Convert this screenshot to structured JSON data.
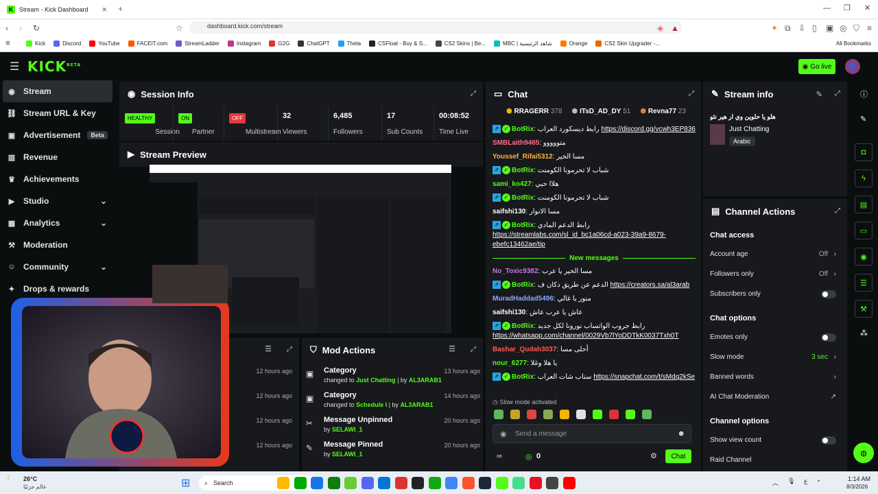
{
  "browser": {
    "tab_title": "Stream - Kick Dashboard",
    "url": "dashboard.kick.com/stream",
    "bookmarks": [
      {
        "label": "Kick",
        "color": "#53fc18"
      },
      {
        "label": "Discord",
        "color": "#5865f2"
      },
      {
        "label": "YouTube",
        "color": "#ff0000"
      },
      {
        "label": "FACEIT.com",
        "color": "#ff5500"
      },
      {
        "label": "StreamLadder",
        "color": "#6a5acd"
      },
      {
        "label": "Instagram",
        "color": "#c13584"
      },
      {
        "label": "G2G",
        "color": "#d33"
      },
      {
        "label": "ChatGPT",
        "color": "#333"
      },
      {
        "label": "Theta",
        "color": "#2a9df4"
      },
      {
        "label": "CSFloat - Buy & S...",
        "color": "#222"
      },
      {
        "label": "CS2 Skins | Be...",
        "color": "#444"
      },
      {
        "label": "MBC | شاهد الرئيسية",
        "color": "#1bb"
      },
      {
        "label": "Orange",
        "color": "#ff7900"
      },
      {
        "label": "CS2 Skin Upgrader -...",
        "color": "#e60"
      }
    ],
    "all_bookmarks": "All Bookmarks"
  },
  "topbar": {
    "logo": "KICK",
    "logo_beta": "BETA",
    "go_live": "Go live"
  },
  "sidebar": {
    "items": [
      {
        "label": "Stream",
        "icon": "broadcast-icon",
        "active": true
      },
      {
        "label": "Stream URL & Key",
        "icon": "link-icon"
      },
      {
        "label": "Advertisement",
        "icon": "ad-icon",
        "badge": "Beta"
      },
      {
        "label": "Revenue",
        "icon": "chart-icon"
      },
      {
        "label": "Achievements",
        "icon": "trophy-icon"
      },
      {
        "label": "Studio",
        "icon": "video-icon",
        "chevron": true
      },
      {
        "label": "Analytics",
        "icon": "analytics-icon",
        "chevron": true
      },
      {
        "label": "Moderation",
        "icon": "hammer-icon"
      },
      {
        "label": "Community",
        "icon": "users-icon",
        "chevron": true
      },
      {
        "label": "Drops & rewards",
        "icon": "gift-icon"
      }
    ]
  },
  "session": {
    "title": "Session Info",
    "stats": [
      {
        "badge": "HEALTHY",
        "badge_color": "#53fc18",
        "label": "Session"
      },
      {
        "badge": "ON",
        "badge_color": "#53fc18",
        "label": "Partner"
      },
      {
        "badge": "OFF",
        "badge_color": "#e53935",
        "label": "Multistream"
      },
      {
        "value": "32",
        "label": "Viewers"
      },
      {
        "value": "6,485",
        "label": "Followers"
      },
      {
        "value": "17",
        "label": "Sub Counts"
      },
      {
        "value": "00:08:52",
        "label": "Time Live"
      }
    ]
  },
  "preview": {
    "title": "Stream Preview"
  },
  "mod_actions": {
    "title": "Mod Actions",
    "items": [
      {
        "title": "Category",
        "sub_pre": "changed to",
        "target": "Just Chatting",
        "by": "AL3ARAB1",
        "time": "13 hours ago"
      },
      {
        "title": "Category",
        "sub_pre": "changed to",
        "target": "Schedule I",
        "by": "AL3ARAB1",
        "time": "14 hours ago"
      },
      {
        "title": "Message Unpinned",
        "sub_pre": "by",
        "target": "SELAWI_1",
        "time": "20 hours ago"
      },
      {
        "title": "Message Pinned",
        "sub_pre": "by",
        "target": "SELAWI_1",
        "time": "20 hours ago"
      }
    ]
  },
  "left_panel_times": [
    "12 hours ago",
    "12 hours ago",
    "12 hours ago",
    "12 hours ago"
  ],
  "chat": {
    "title": "Chat",
    "top": [
      {
        "name": "RRAGERR",
        "count": "378"
      },
      {
        "name": "ITsD_AD_DY",
        "count": "51"
      },
      {
        "name": "Revna77",
        "count": "23"
      }
    ],
    "messages": [
      {
        "user": "BotRix",
        "color": "#53fc18",
        "bot": true,
        "text": "رابط ديسكورد العراب",
        "link": "https://discord.gg/vcwh3EP836"
      },
      {
        "user": "SMBLaith9465",
        "color": "#ff6b8a",
        "text": "متووووو"
      },
      {
        "user": "Youssef_Rifai5312",
        "color": "#ffb347",
        "text": "مسا الخير"
      },
      {
        "user": "BotRix",
        "color": "#53fc18",
        "bot": true,
        "text": "شباب لا تحرمونا الكومنت"
      },
      {
        "user": "sami_ko427",
        "color": "#53fc18",
        "text": "هلاا حبي"
      },
      {
        "user": "BotRix",
        "color": "#53fc18",
        "bot": true,
        "text": "شباب لا تحرمونا الكومنت"
      },
      {
        "user": "saifshi130",
        "color": "#ffffff",
        "text": "مسا الانوار"
      },
      {
        "user": "BotRix",
        "color": "#53fc18",
        "bot": true,
        "text": "رابط الدعم المادي",
        "link": "https://streamlabs.com/sl_id_bc1a06cd-a023-39a9-8679-ebefc13462ae/tip"
      }
    ],
    "new_messages": "New messages",
    "messages2": [
      {
        "user": "No_Toxic9382",
        "color": "#c678dd",
        "text": "مسا الخير يا عرب"
      },
      {
        "user": "BotRix",
        "color": "#53fc18",
        "bot": true,
        "text": "الدعم عن طريق دكان ف",
        "link": "https://creators.sa/al3arab"
      },
      {
        "user": "MuradHaddad5496",
        "color": "#8fa8ff",
        "text": "منور يا غالي"
      },
      {
        "user": "saifshi130",
        "color": "#ffffff",
        "text": "عاش يا عرب عاش"
      },
      {
        "user": "BotRix",
        "color": "#53fc18",
        "bot": true,
        "text": "رابط جروب الواتساب نورونا لكل جديد",
        "link": "https://whatsapp.com/channel/0029Vb7lYoDDTkK0037Txh0T"
      },
      {
        "user": "Bashar_Qudah3037",
        "color": "#ff5a5a",
        "text": "أحلى مسا"
      },
      {
        "user": "nour_6277",
        "color": "#53fc18",
        "text": "يا هلا وغلا"
      },
      {
        "user": "BotRix",
        "color": "#53fc18",
        "bot": true,
        "text": "سناب شات العراب",
        "link": "https://snapchat.com/t/sMdq2kSe"
      }
    ],
    "slow_mode": "Slow mode activated",
    "placeholder": "Send a message",
    "count": "0",
    "send": "Chat"
  },
  "stream_info": {
    "title": "Stream info",
    "stream_title": "هلو يا حلوين وي ار هير نئو",
    "category": "Just Chatting",
    "tag": "Arabic"
  },
  "channel_actions": {
    "title": "Channel Actions",
    "chat_access": "Chat access",
    "account_age": {
      "label": "Account age",
      "value": "Off"
    },
    "followers_only": {
      "label": "Followers only",
      "value": "Off"
    },
    "subscribers_only": "Subscribers only",
    "chat_options": "Chat options",
    "emotes_only": "Emotes only",
    "slow_mode": {
      "label": "Slow mode",
      "value": "3 sec"
    },
    "banned_words": "Banned words",
    "ai_moderation": "AI Chat Moderation",
    "channel_options": "Channel options",
    "show_view_count": "Show view count",
    "raid_channel": "Raid Channel"
  },
  "taskbar": {
    "weather_temp": "26°C",
    "weather_desc": "عالم جزئيًا",
    "search": "Search",
    "time": "1:14 AM",
    "date": "8/3/2026"
  },
  "colors": {
    "accent": "#53fc18",
    "panel": "#17191c",
    "bg": "#0b0e0f"
  }
}
